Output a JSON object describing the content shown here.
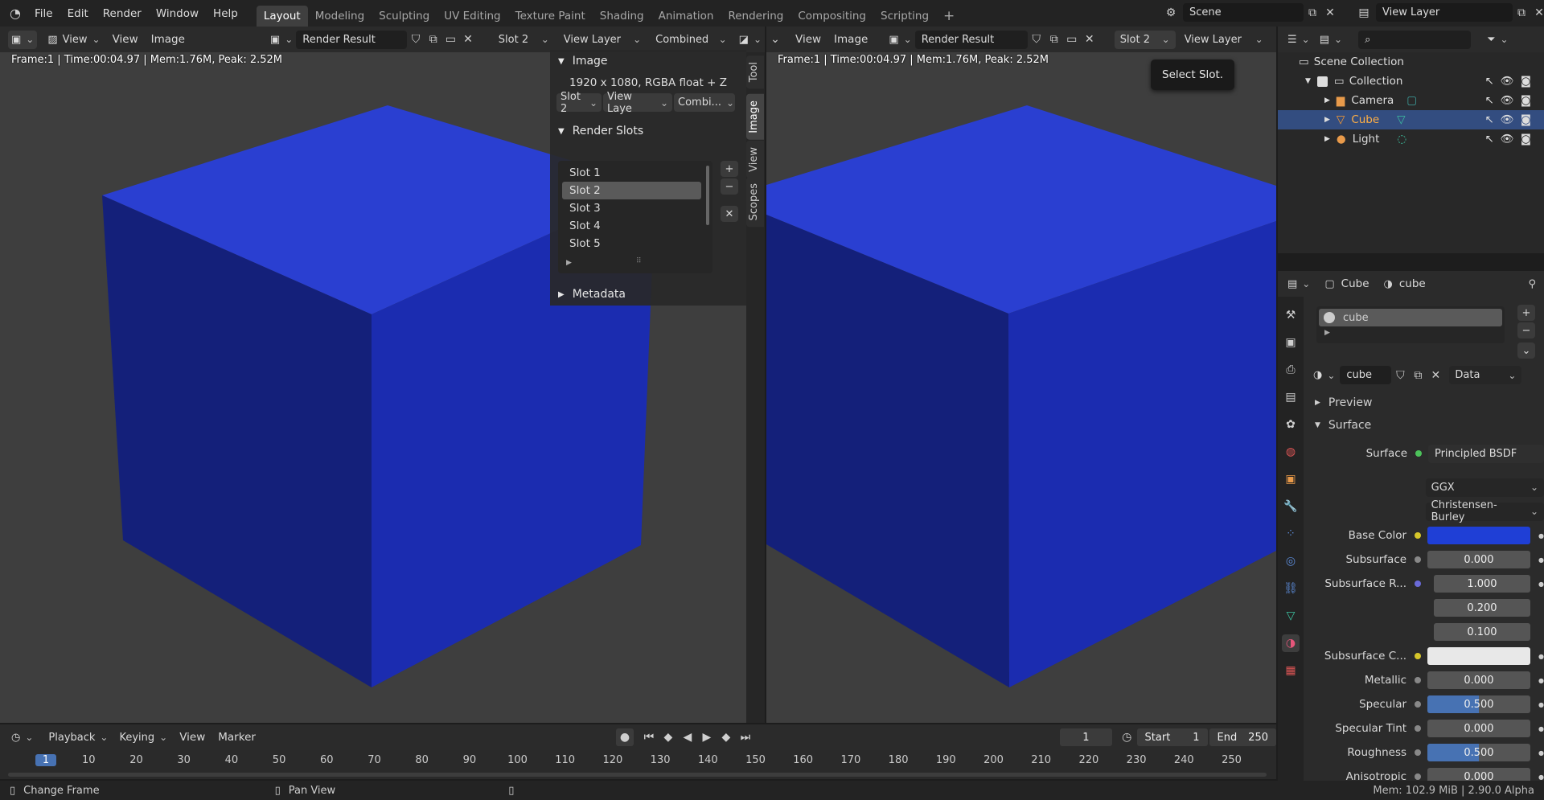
{
  "topbar": {
    "menus": [
      "File",
      "Edit",
      "Render",
      "Window",
      "Help"
    ],
    "workspaces": [
      "Layout",
      "Modeling",
      "Sculpting",
      "UV Editing",
      "Texture Paint",
      "Shading",
      "Animation",
      "Rendering",
      "Compositing",
      "Scripting"
    ],
    "active_workspace": "Layout",
    "add_tab": "+",
    "scene": "Scene",
    "view_layer": "View Layer"
  },
  "left_editor": {
    "view_menu": "View",
    "menu_view": "View",
    "menu_image": "Image",
    "image_name": "Render Result",
    "slot": "Slot 2",
    "layer": "View Layer",
    "pass": "Combined",
    "overlay": "Frame:1 | Time:00:04.97 | Mem:1.76M, Peak: 2.52M"
  },
  "npanel": {
    "image_header": "Image",
    "image_info": "1920 x 1080,  RGBA float + Z",
    "slot_short": "Slot 2",
    "layer_short": "View Laye",
    "pass_short": "Combi...",
    "render_slots_header": "Render Slots",
    "slots": [
      "Slot 1",
      "Slot 2",
      "Slot 3",
      "Slot 4",
      "Slot 5"
    ],
    "selected_slot": "Slot 2",
    "metadata_header": "Metadata",
    "tabs": [
      "Tool",
      "Image",
      "View",
      "Scopes"
    ]
  },
  "right_editor": {
    "menu_view": "View",
    "menu_image": "Image",
    "image_name": "Render Result",
    "slot": "Slot 2",
    "layer": "View Layer",
    "overlay": "Frame:1 | Time:00:04.97 | Mem:1.76M, Peak: 2.52M",
    "tooltip": "Select Slot."
  },
  "outliner": {
    "scene_collection": "Scene Collection",
    "collection": "Collection",
    "items": [
      "Camera",
      "Cube",
      "Light"
    ],
    "active_item": "Cube"
  },
  "properties": {
    "object_name": "Cube",
    "material_name": "cube",
    "slot_material": "cube",
    "material_field": "cube",
    "link": "Data",
    "preview": "Preview",
    "surface_section": "Surface",
    "surface_label": "Surface",
    "surface_value": "Principled BSDF",
    "distribution": "GGX",
    "subsurface_method": "Christensen-Burley",
    "base_color_label": "Base Color",
    "base_color": "#1f3fd6",
    "rows": [
      {
        "label": "Subsurface",
        "value": "0.000",
        "fill": 0
      },
      {
        "label": "Subsurface R...",
        "value": "1.000",
        "fill": 0
      },
      {
        "label": "",
        "value": "0.200",
        "fill": 0
      },
      {
        "label": "",
        "value": "0.100",
        "fill": 0
      },
      {
        "label": "Subsurface C...",
        "value": "",
        "fill": 0
      },
      {
        "label": "Metallic",
        "value": "0.000",
        "fill": 0
      },
      {
        "label": "Specular",
        "value": "0.500",
        "fill": 0.5
      },
      {
        "label": "Specular Tint",
        "value": "0.000",
        "fill": 0
      },
      {
        "label": "Roughness",
        "value": "0.500",
        "fill": 0.5
      },
      {
        "label": "Anisotropic",
        "value": "0.000",
        "fill": 0
      }
    ]
  },
  "timeline": {
    "menus": [
      "Playback",
      "Keying",
      "View",
      "Marker"
    ],
    "current_frame": "1",
    "start_label": "Start",
    "start": "1",
    "end_label": "End",
    "end": "250",
    "ticks": [
      "1",
      "10",
      "20",
      "30",
      "40",
      "50",
      "60",
      "70",
      "80",
      "90",
      "100",
      "110",
      "120",
      "130",
      "140",
      "150",
      "160",
      "170",
      "180",
      "190",
      "200",
      "210",
      "220",
      "230",
      "240",
      "250"
    ]
  },
  "statusbar": {
    "left": "Change Frame",
    "middle": "Pan View",
    "right": "Mem: 102.9 MiB | 2.90.0 Alpha"
  },
  "colors": {
    "cube_top": "#2a3fd1",
    "cube_front": "#14207a",
    "cube_side": "#1b2cb0",
    "accent": "#4772b3",
    "active_object": "#ff9d2f"
  }
}
